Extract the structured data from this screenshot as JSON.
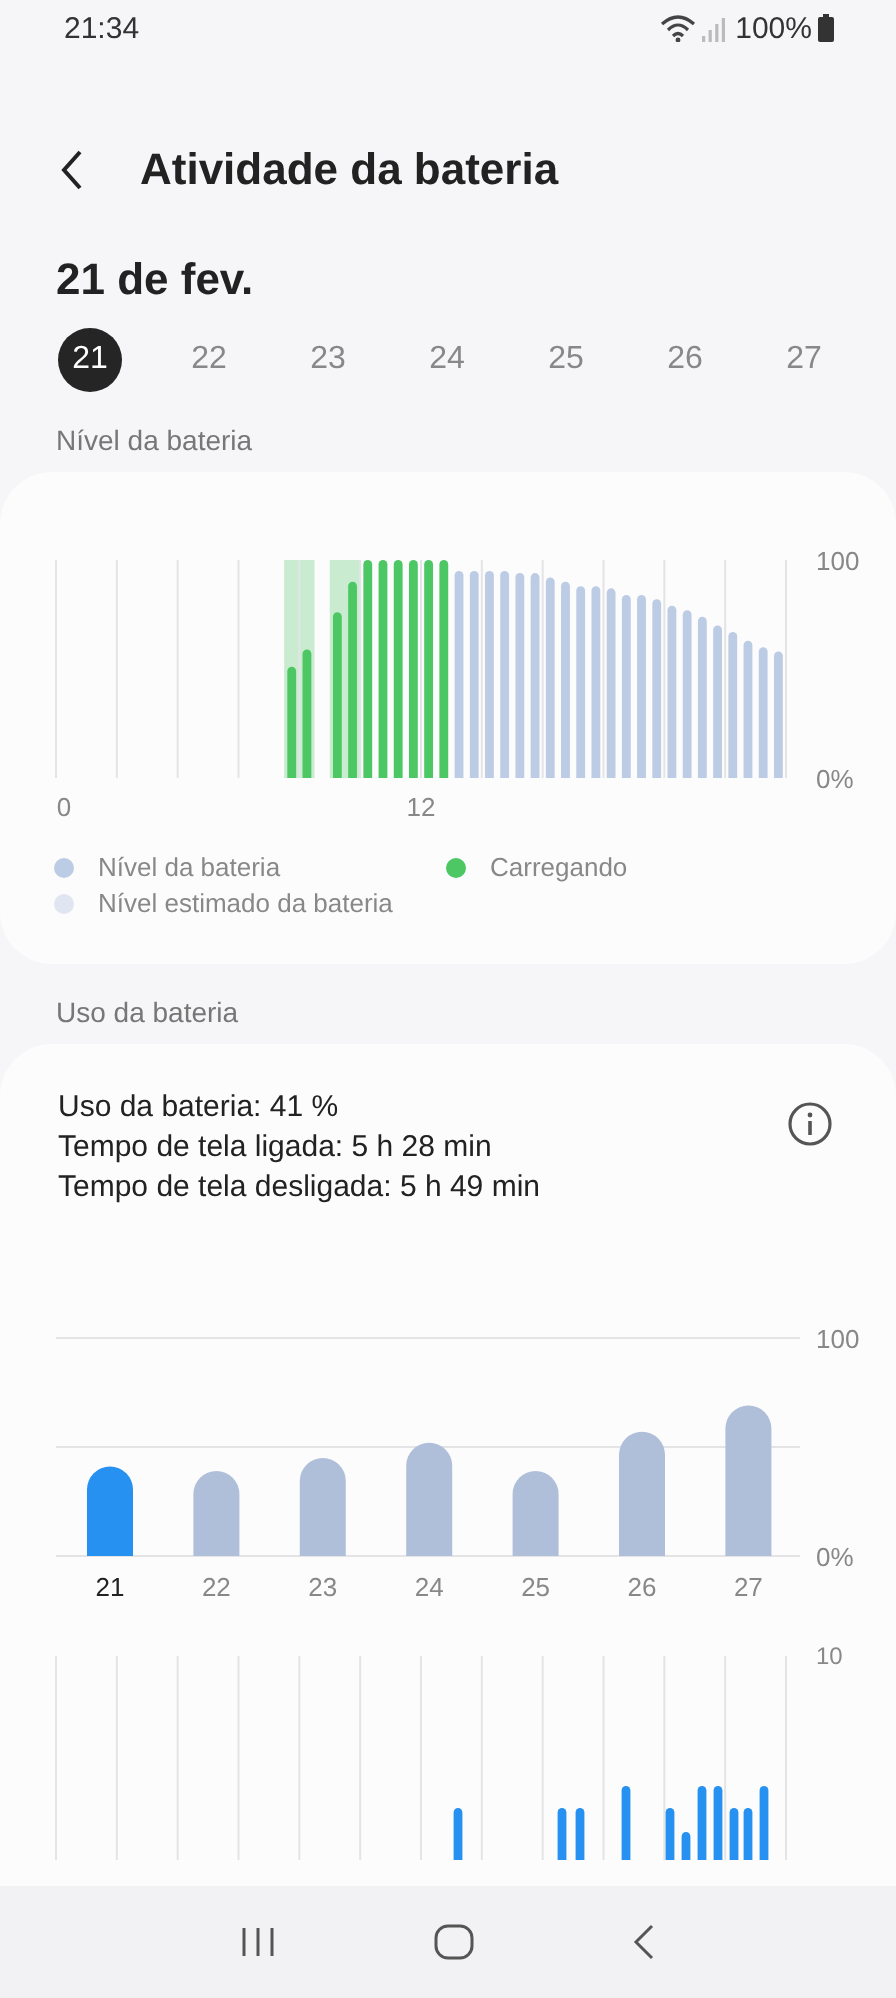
{
  "status_bar": {
    "time": "21:34",
    "battery": "100%"
  },
  "header": {
    "title": "Atividade da bateria"
  },
  "date": "21 de fev.",
  "days": [
    {
      "label": "21",
      "selected": true
    },
    {
      "label": "22",
      "selected": false
    },
    {
      "label": "23",
      "selected": false
    },
    {
      "label": "24",
      "selected": false
    },
    {
      "label": "25",
      "selected": false
    },
    {
      "label": "26",
      "selected": false
    },
    {
      "label": "27",
      "selected": false
    }
  ],
  "level_section": {
    "title": "Nível da bateria",
    "chart_data": {
      "type": "bar",
      "x": [
        7.5,
        8,
        8.5,
        9,
        9.5,
        10,
        10.5,
        11,
        11.5,
        12,
        12.5,
        13,
        13.5,
        14,
        14.5,
        15,
        15.5,
        16,
        16.5,
        17,
        17.5,
        18,
        18.5,
        19,
        19.5,
        20,
        20.5,
        21,
        21.5,
        22,
        22.5,
        23,
        23.5
      ],
      "series": [
        {
          "name": "Nível da bateria",
          "color": "#bccce4",
          "values": [
            null,
            null,
            null,
            null,
            null,
            null,
            null,
            null,
            null,
            null,
            null,
            95,
            95,
            95,
            95,
            94,
            94,
            92,
            90,
            88,
            88,
            87,
            84,
            84,
            82,
            79,
            77,
            74,
            70,
            67,
            63,
            60,
            58
          ]
        },
        {
          "name": "Carregando",
          "color": "#4cc764",
          "values": [
            51,
            59,
            null,
            76,
            90,
            100,
            100,
            100,
            100,
            100,
            100,
            null,
            null,
            null,
            null,
            null,
            null,
            null,
            null,
            null,
            null,
            null,
            null,
            null,
            null,
            null,
            null,
            null,
            null,
            null,
            null,
            null,
            null
          ]
        },
        {
          "name": "Nível estimado da bateria",
          "color": "#dfe6f1",
          "values": [
            null,
            null,
            null,
            null,
            null,
            null,
            null,
            null,
            null,
            null,
            null,
            null,
            null,
            null,
            null,
            null,
            null,
            null,
            null,
            null,
            null,
            null,
            null,
            null,
            null,
            null,
            null,
            null,
            null,
            null,
            null,
            null,
            null
          ]
        }
      ],
      "xlim": [
        0,
        24
      ],
      "ylim": [
        0,
        100
      ],
      "xticks": [
        0,
        12
      ],
      "yticks": [
        {
          "value": 0,
          "label": "0%"
        },
        {
          "value": 100,
          "label": "100"
        }
      ]
    }
  },
  "usage_section": {
    "title": "Uso da bateria",
    "summary": [
      "Uso da bateria: 41 %",
      "Tempo de tela ligada: 5 h 28 min",
      "Tempo de tela desligada: 5 h 49 min"
    ],
    "chart_data": {
      "type": "bar",
      "categories": [
        "21",
        "22",
        "23",
        "24",
        "25",
        "26",
        "27"
      ],
      "series": [
        {
          "color": "#2691f0",
          "values": [
            41,
            null,
            null,
            null,
            null,
            null,
            null
          ]
        },
        {
          "color": "#b0bfd9",
          "values": [
            null,
            39,
            45,
            52,
            39,
            57,
            69
          ]
        }
      ],
      "ylim": [
        0,
        100
      ],
      "yticks": [
        {
          "value": 0,
          "label": "0%"
        },
        {
          "value": 100,
          "label": "100"
        }
      ]
    }
  },
  "screen_chart": {
    "ytick_label": "10"
  }
}
